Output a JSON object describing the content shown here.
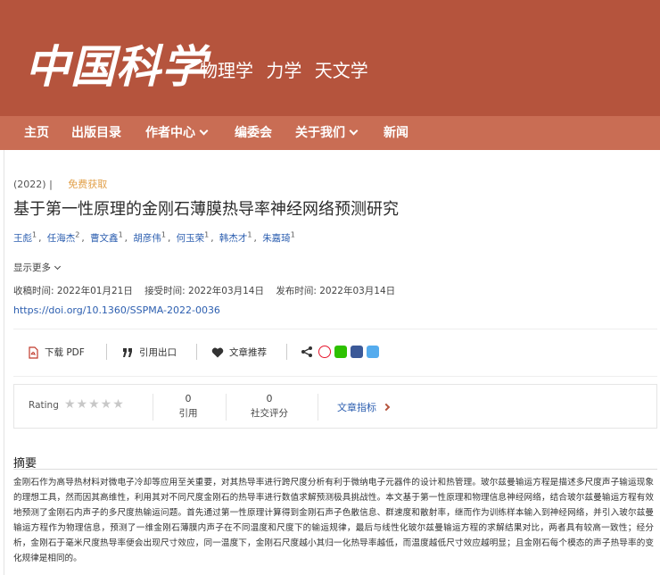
{
  "header": {
    "logo_text": "中国科学",
    "subjects": [
      "物理学",
      "力学",
      "天文学"
    ]
  },
  "nav": {
    "items": [
      {
        "label": "主页"
      },
      {
        "label": "出版目录"
      },
      {
        "label": "作者中心"
      },
      {
        "label": "编委会"
      },
      {
        "label": "关于我们"
      },
      {
        "label": "新闻"
      }
    ]
  },
  "article": {
    "year": "(2022)",
    "separator": "|",
    "access": "免费获取",
    "title": "基于第一性原理的金刚石薄膜热导率神经网络预测研究",
    "authors": [
      {
        "name": "王彪",
        "aff": "1"
      },
      {
        "name": "任海杰",
        "aff": "2"
      },
      {
        "name": "曹文鑫",
        "aff": "1"
      },
      {
        "name": "胡彦伟",
        "aff": "1"
      },
      {
        "name": "何玉荣",
        "aff": "1"
      },
      {
        "name": "韩杰才",
        "aff": "1"
      },
      {
        "name": "朱嘉琦",
        "aff": "1"
      }
    ],
    "show_more": "显示更多",
    "received": "收稿时间: 2022年01月21日",
    "accepted": "接受时间: 2022年03月14日",
    "published": "发布时间: 2022年03月14日",
    "doi": "https://doi.org/10.1360/SSPMA-2022-0036"
  },
  "toolbar": {
    "download_pdf": "下载 PDF",
    "cite": "引用出口",
    "recommend": "文章推荐"
  },
  "metrics": {
    "rating_label": "Rating",
    "stars": "★★★★★",
    "citations_count": "0",
    "citations_label": "引用",
    "social_count": "0",
    "social_label": "社交评分",
    "indicator_label": "文章指标"
  },
  "abstract": {
    "heading": "摘要",
    "text": "金刚石作为高导热材料对微电子冷却等应用至关重要，对其热导率进行跨尺度分析有利于微纳电子元器件的设计和热管理。玻尔兹曼输运方程是描述多尺度声子输运现象的理想工具，然而因其高维性，利用其对不同尺度金刚石的热导率进行数值求解预测极具挑战性。本文基于第一性原理和物理信息神经网络，结合玻尔兹曼输运方程有效地预测了金刚石内声子的多尺度热输运问题。首先通过第一性原理计算得到金刚石声子色散信息、群速度和散射率，继而作为训练样本输入到神经网络，并引入玻尔兹曼输运方程作为物理信息，预测了一维金刚石薄膜内声子在不同温度和尺度下的输运规律，最后与线性化玻尔兹曼输运方程的求解结果对比，两者具有较高一致性；经分析，金刚石于毫米尺度热导率便会出现尺寸效应，同一温度下，金刚石尺度越小其归一化热导率越低，而温度越低尺寸效应越明显；且金刚石每个模态的声子热导率的变化规律是相同的。"
  }
}
